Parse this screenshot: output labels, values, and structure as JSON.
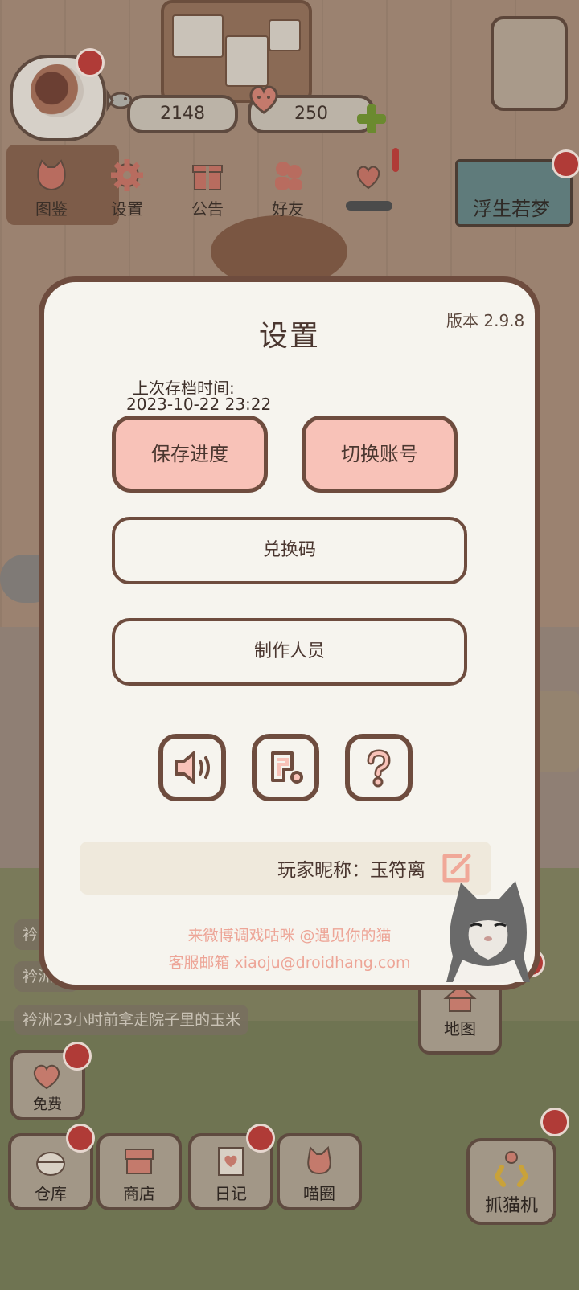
{
  "hud": {
    "fish_count": "2148",
    "heart_count": "250"
  },
  "top_menu": [
    {
      "label": "图鉴"
    },
    {
      "label": "设置"
    },
    {
      "label": "公告"
    },
    {
      "label": "好友"
    }
  ],
  "dream_banner": "浮生若梦",
  "feed": {
    "line1": "衿",
    "line2": "衿洲",
    "line3": "衿洲23小时前拿走院子里的玉米"
  },
  "bottom_bar": {
    "free": "免费",
    "warehouse": "仓库",
    "shop": "商店",
    "diary": "日记",
    "circle": "喵圈",
    "claw": "抓猫机",
    "map": "地图"
  },
  "dialog": {
    "title": "设置",
    "version": "版本 2.9.8",
    "save_time_label": "上次存档时间:",
    "save_time": "2023-10-22 23:22",
    "save_button": "保存进度",
    "switch_account_button": "切换账号",
    "redeem_button": "兑换码",
    "credits_button": "制作人员",
    "nickname": "玩家昵称：玉符离",
    "weibo_text": "来微博调戏咕咪 @遇见你的猫",
    "email_text": "客服邮箱 xiaoju@droidhang.com"
  },
  "colors": {
    "accent_pink": "#f8c2b8",
    "border_brown": "#6e4c3e",
    "dialog_bg": "#f6f4ee",
    "link_pink": "#eda597"
  }
}
